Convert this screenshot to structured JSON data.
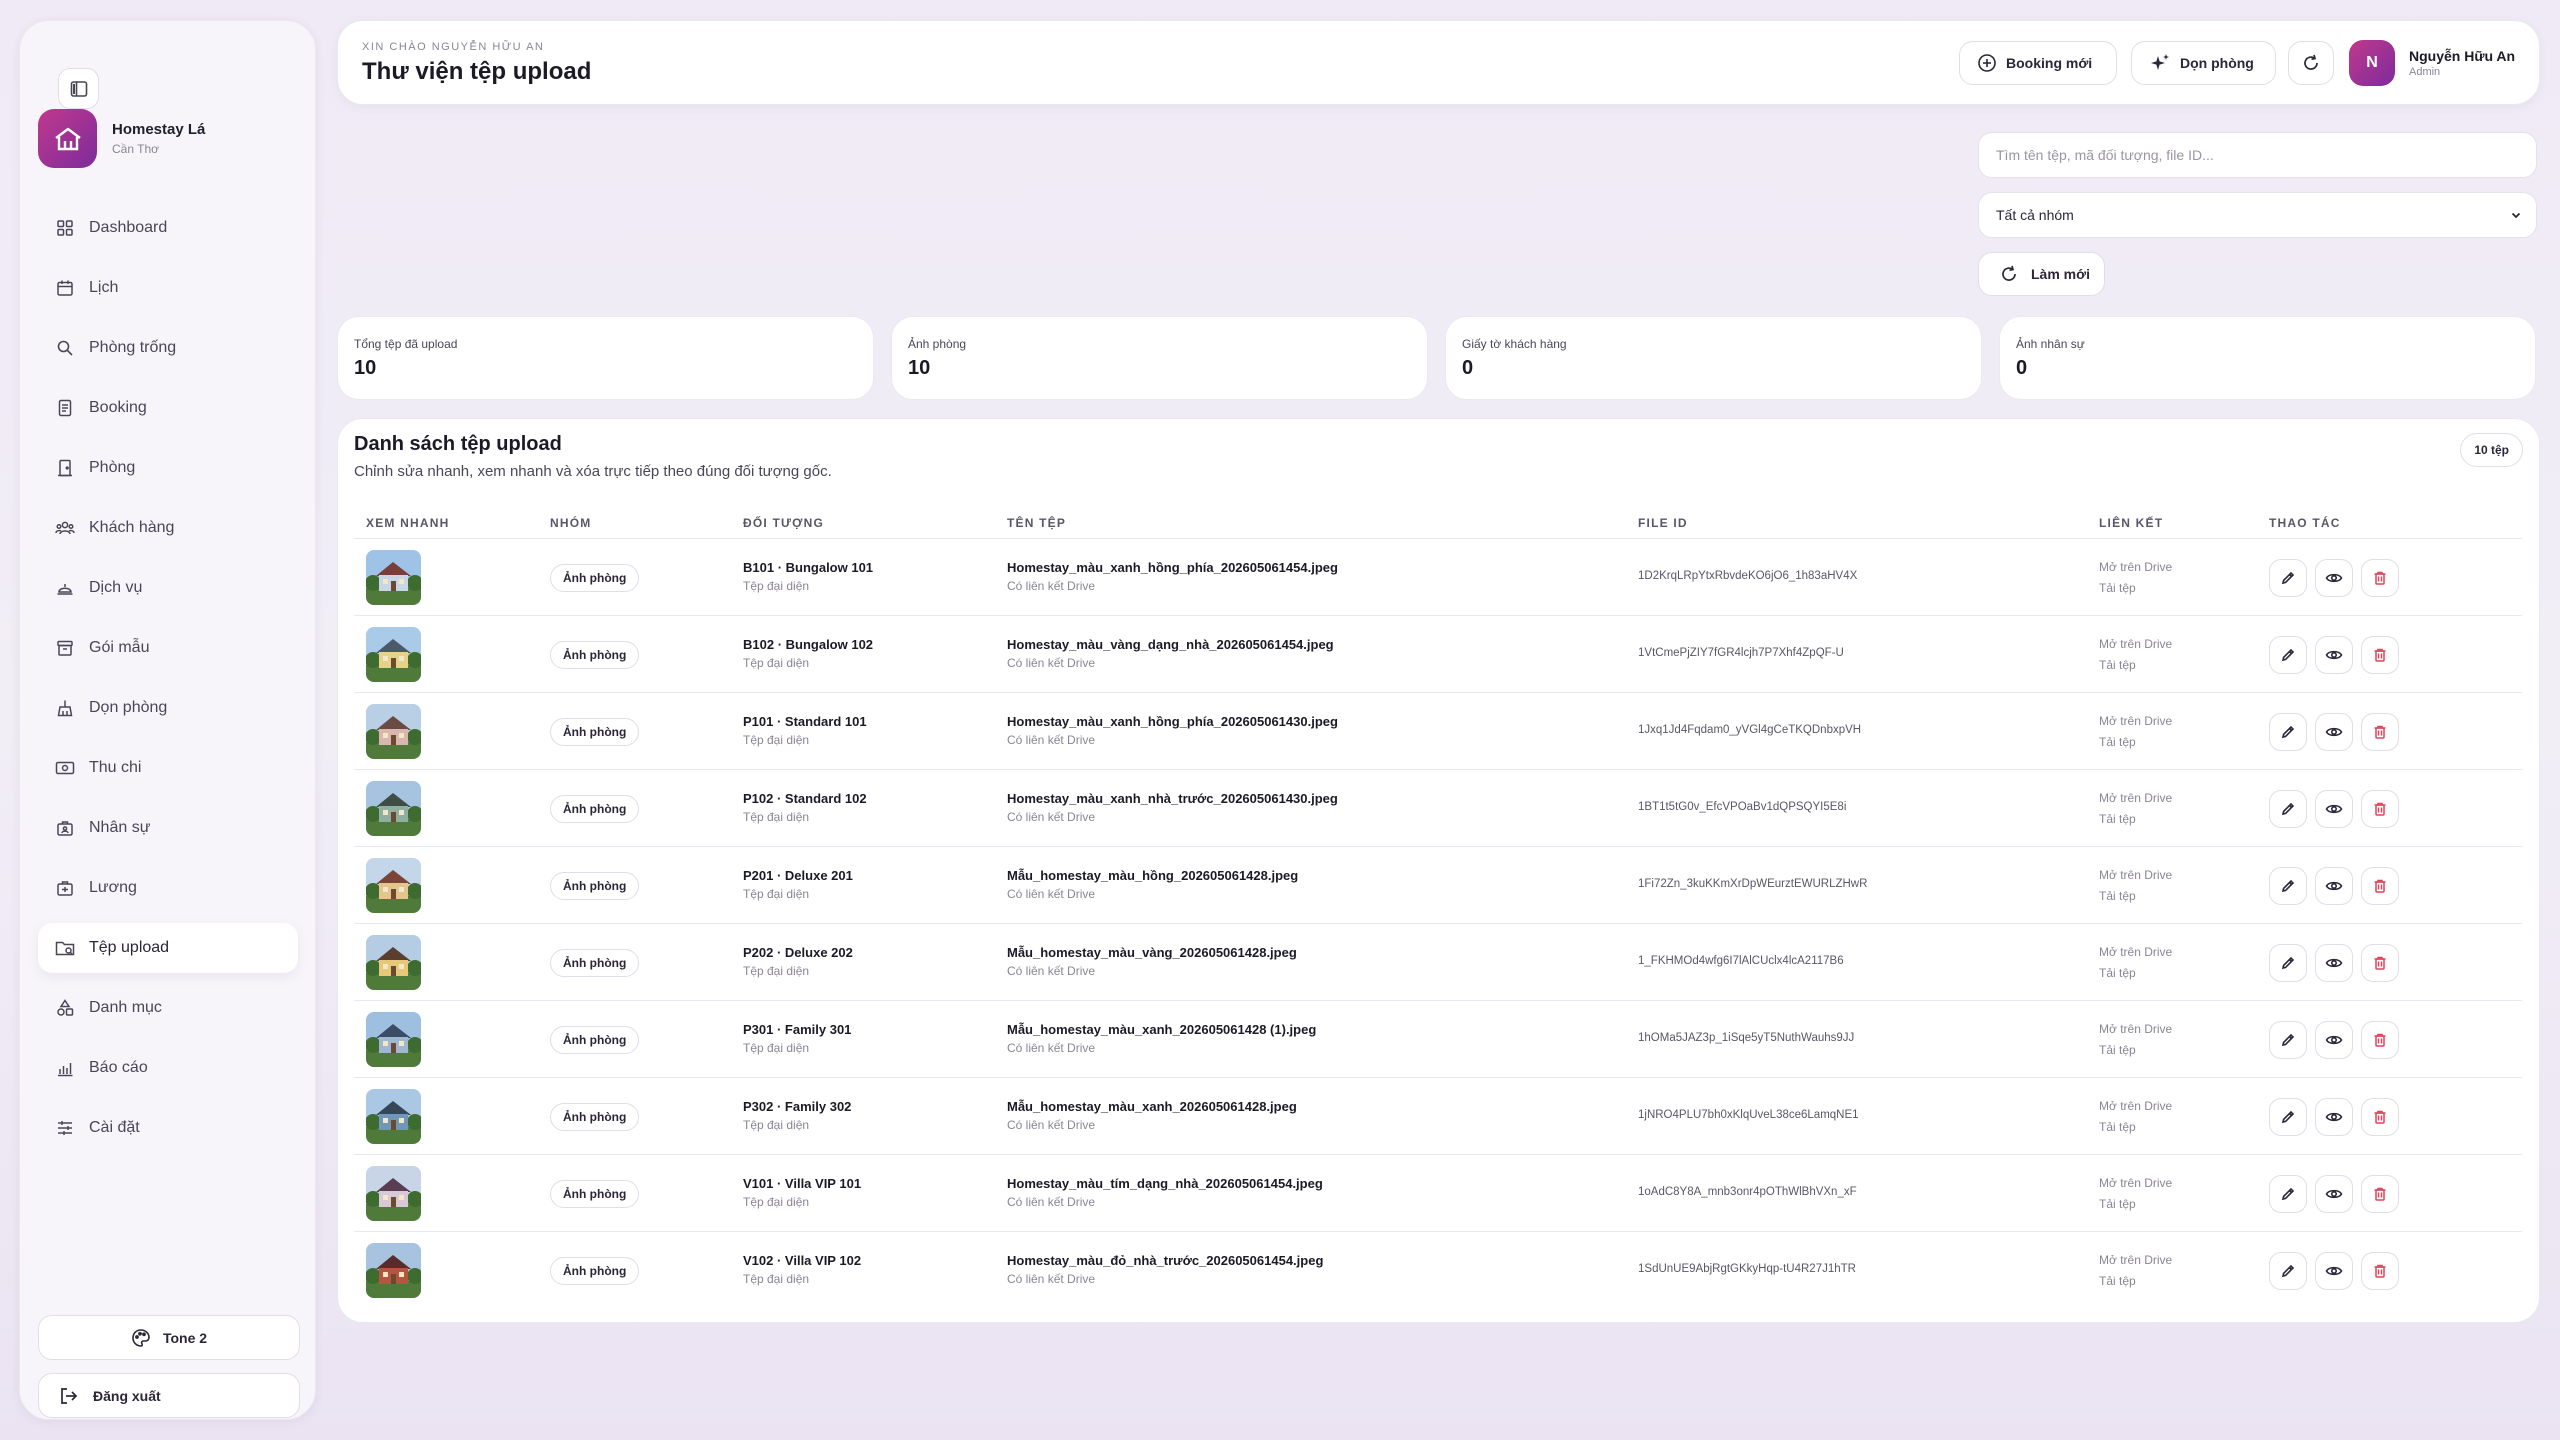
{
  "brand": {
    "name": "Homestay Lá",
    "location": "Cần Thơ"
  },
  "sidebar": {
    "items": [
      {
        "label": "Dashboard",
        "icon": "grid-icon"
      },
      {
        "label": "Lịch",
        "icon": "calendar-icon"
      },
      {
        "label": "Phòng trống",
        "icon": "search-icon"
      },
      {
        "label": "Booking",
        "icon": "receipt-icon"
      },
      {
        "label": "Phòng",
        "icon": "door-icon"
      },
      {
        "label": "Khách hàng",
        "icon": "users-icon"
      },
      {
        "label": "Dịch vụ",
        "icon": "service-bell-icon"
      },
      {
        "label": "Gói mẫu",
        "icon": "archive-icon"
      },
      {
        "label": "Dọn phòng",
        "icon": "broom-icon"
      },
      {
        "label": "Thu chi",
        "icon": "money-icon"
      },
      {
        "label": "Nhân sự",
        "icon": "staff-icon"
      },
      {
        "label": "Lương",
        "icon": "payroll-icon"
      },
      {
        "label": "Tệp upload",
        "icon": "folder-icon",
        "active": true
      },
      {
        "label": "Danh mục",
        "icon": "shapes-icon"
      },
      {
        "label": "Báo cáo",
        "icon": "chart-icon"
      },
      {
        "label": "Cài đặt",
        "icon": "sliders-icon"
      }
    ],
    "tone_label": "Tone 2",
    "logout_label": "Đăng xuất"
  },
  "header": {
    "greeting": "XIN CHÀO NGUYỄN HỮU AN",
    "title": "Thư viện tệp upload",
    "booking_btn": "Booking mới",
    "clean_btn": "Dọn phòng",
    "user_initial": "N",
    "user_name": "Nguyễn Hữu An",
    "user_role": "Admin"
  },
  "filters": {
    "search_placeholder": "Tìm tên tệp, mã đối tượng, file ID...",
    "group_selected": "Tất cả nhóm",
    "reload_label": "Làm mới"
  },
  "stats": [
    {
      "label": "Tổng tệp đã upload",
      "value": "10"
    },
    {
      "label": "Ảnh phòng",
      "value": "10"
    },
    {
      "label": "Giấy tờ khách hàng",
      "value": "0"
    },
    {
      "label": "Ảnh nhân sự",
      "value": "0"
    }
  ],
  "table": {
    "title": "Danh sách tệp upload",
    "subtitle": "Chỉnh sửa nhanh, xem nhanh và xóa trực tiếp theo đúng đối tượng gốc.",
    "count_badge": "10 tệp",
    "headers": [
      "XEM NHANH",
      "NHÓM",
      "ĐỐI TƯỢNG",
      "TÊN TỆP",
      "FILE ID",
      "LIÊN KẾT",
      "THAO TÁC"
    ],
    "rows": [
      {
        "group": "Ảnh phòng",
        "object": "B101 · Bungalow 101",
        "object_sub": "Tệp đại diện",
        "file": "Homestay_màu_xanh_hồng_phía_202605061454.jpeg",
        "file_sub": "Có liên kết Drive",
        "file_id": "1D2KrqLRpYtxRbvdeKO6jO6_1h83aHV4X",
        "link_open": "Mở trên Drive",
        "link_download": "Tải tệp"
      },
      {
        "group": "Ảnh phòng",
        "object": "B102 · Bungalow 102",
        "object_sub": "Tệp đại diện",
        "file": "Homestay_màu_vàng_dạng_nhà_202605061454.jpeg",
        "file_sub": "Có liên kết Drive",
        "file_id": "1VtCmePjZIY7fGR4lcjh7P7Xhf4ZpQF-U",
        "link_open": "Mở trên Drive",
        "link_download": "Tải tệp"
      },
      {
        "group": "Ảnh phòng",
        "object": "P101 · Standard 101",
        "object_sub": "Tệp đại diện",
        "file": "Homestay_màu_xanh_hồng_phía_202605061430.jpeg",
        "file_sub": "Có liên kết Drive",
        "file_id": "1Jxq1Jd4Fqdam0_yVGl4gCeTKQDnbxpVH",
        "link_open": "Mở trên Drive",
        "link_download": "Tải tệp"
      },
      {
        "group": "Ảnh phòng",
        "object": "P102 · Standard 102",
        "object_sub": "Tệp đại diện",
        "file": "Homestay_màu_xanh_nhà_trước_202605061430.jpeg",
        "file_sub": "Có liên kết Drive",
        "file_id": "1BT1t5tG0v_EfcVPOaBv1dQPSQYI5E8i",
        "link_open": "Mở trên Drive",
        "link_download": "Tải tệp"
      },
      {
        "group": "Ảnh phòng",
        "object": "P201 · Deluxe 201",
        "object_sub": "Tệp đại diện",
        "file": "Mẫu_homestay_màu_hồng_202605061428.jpeg",
        "file_sub": "Có liên kết Drive",
        "file_id": "1Fi72Zn_3kuKKmXrDpWEurztEWURLZHwR",
        "link_open": "Mở trên Drive",
        "link_download": "Tải tệp"
      },
      {
        "group": "Ảnh phòng",
        "object": "P202 · Deluxe 202",
        "object_sub": "Tệp đại diện",
        "file": "Mẫu_homestay_màu_vàng_202605061428.jpeg",
        "file_sub": "Có liên kết Drive",
        "file_id": "1_FKHMOd4wfg6I7lAlCUclx4lcA2117B6",
        "link_open": "Mở trên Drive",
        "link_download": "Tải tệp"
      },
      {
        "group": "Ảnh phòng",
        "object": "P301 · Family 301",
        "object_sub": "Tệp đại diện",
        "file": "Mẫu_homestay_màu_xanh_202605061428 (1).jpeg",
        "file_sub": "Có liên kết Drive",
        "file_id": "1hOMa5JAZ3p_1iSqe5yT5NuthWauhs9JJ",
        "link_open": "Mở trên Drive",
        "link_download": "Tải tệp"
      },
      {
        "group": "Ảnh phòng",
        "object": "P302 · Family 302",
        "object_sub": "Tệp đại diện",
        "file": "Mẫu_homestay_màu_xanh_202605061428.jpeg",
        "file_sub": "Có liên kết Drive",
        "file_id": "1jNRO4PLU7bh0xKlqUveL38ce6LamqNE1",
        "link_open": "Mở trên Drive",
        "link_download": "Tải tệp"
      },
      {
        "group": "Ảnh phòng",
        "object": "V101 · Villa VIP 101",
        "object_sub": "Tệp đại diện",
        "file": "Homestay_màu_tím_dạng_nhà_202605061454.jpeg",
        "file_sub": "Có liên kết Drive",
        "file_id": "1oAdC8Y8A_mnb3onr4pOThWlBhVXn_xF",
        "link_open": "Mở trên Drive",
        "link_download": "Tải tệp"
      },
      {
        "group": "Ảnh phòng",
        "object": "V102 · Villa VIP 102",
        "object_sub": "Tệp đại diện",
        "file": "Homestay_màu_đỏ_nhà_trước_202605061454.jpeg",
        "file_sub": "Có liên kết Drive",
        "file_id": "1SdUnUE9AbjRgtGKkyHqp-tU4R27J1hTR",
        "link_open": "Mở trên Drive",
        "link_download": "Tải tệp"
      }
    ]
  },
  "colors": {
    "brand_gradient_start": "#c0398c",
    "brand_gradient_end": "#7d2b9c",
    "delete": "#e0445a"
  }
}
